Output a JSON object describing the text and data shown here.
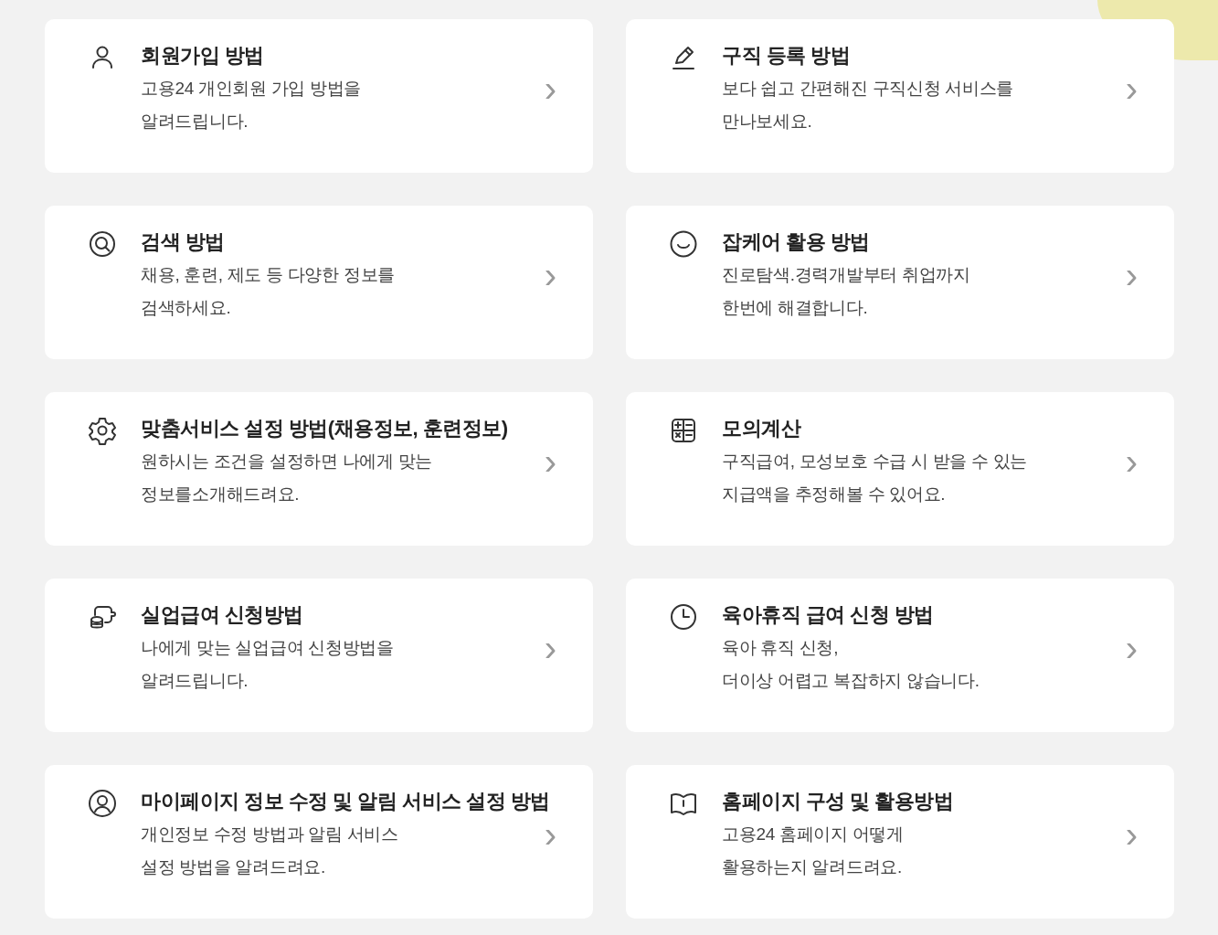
{
  "cards": [
    {
      "kind": "person",
      "title": "회원가입 방법",
      "description": [
        "고용24 개인회원 가입 방법을",
        "알려드립니다."
      ],
      "arrow": "›"
    },
    {
      "kind": "pencil",
      "title": "구직 등록 방법",
      "description": [
        "보다 쉽고 간편해진 구직신청 서비스를",
        "만나보세요."
      ],
      "arrow": "›"
    },
    {
      "kind": "search",
      "title": "검색 방법",
      "description": [
        "채용, 훈련, 제도 등 다양한 정보를",
        "검색하세요."
      ],
      "arrow": "›"
    },
    {
      "kind": "smile",
      "title": "잡케어 활용 방법",
      "description": [
        "진로탐색.경력개발부터 취업까지",
        "한번에 해결합니다."
      ],
      "arrow": "›"
    },
    {
      "kind": "gear",
      "title": "맞춤서비스 설정 방법(채용정보, 훈련정보)",
      "description": [
        "원하시는 조건을 설정하면 나에게 맞는",
        "정보를소개해드려요."
      ],
      "arrow": "›"
    },
    {
      "kind": "calculator",
      "title": "모의계산",
      "description": [
        "구직급여, 모성보호 수급 시 받을 수 있는",
        "지급액을 추정해볼 수 있어요."
      ],
      "arrow": "›"
    },
    {
      "kind": "coins",
      "title": "실업급여 신청방법",
      "description": [
        "나에게 맞는 실업급여 신청방법을",
        "알려드립니다."
      ],
      "arrow": "›"
    },
    {
      "kind": "clock",
      "title": "육아휴직 급여 신청 방법",
      "description": [
        "육아 휴직 신청,",
        "더이상 어렵고 복잡하지 않습니다."
      ],
      "arrow": "›"
    },
    {
      "kind": "usercircle",
      "title": "마이페이지 정보 수정 및 알림 서비스 설정 방법",
      "description": [
        "개인정보 수정 방법과 알림 서비스",
        "설정 방법을 알려드려요."
      ],
      "arrow": "›"
    },
    {
      "kind": "book",
      "title": "홈페이지 구성 및 활용방법",
      "description": [
        "고용24 홈페이지 어떻게",
        "활용하는지 알려드려요."
      ],
      "arrow": "›"
    }
  ]
}
